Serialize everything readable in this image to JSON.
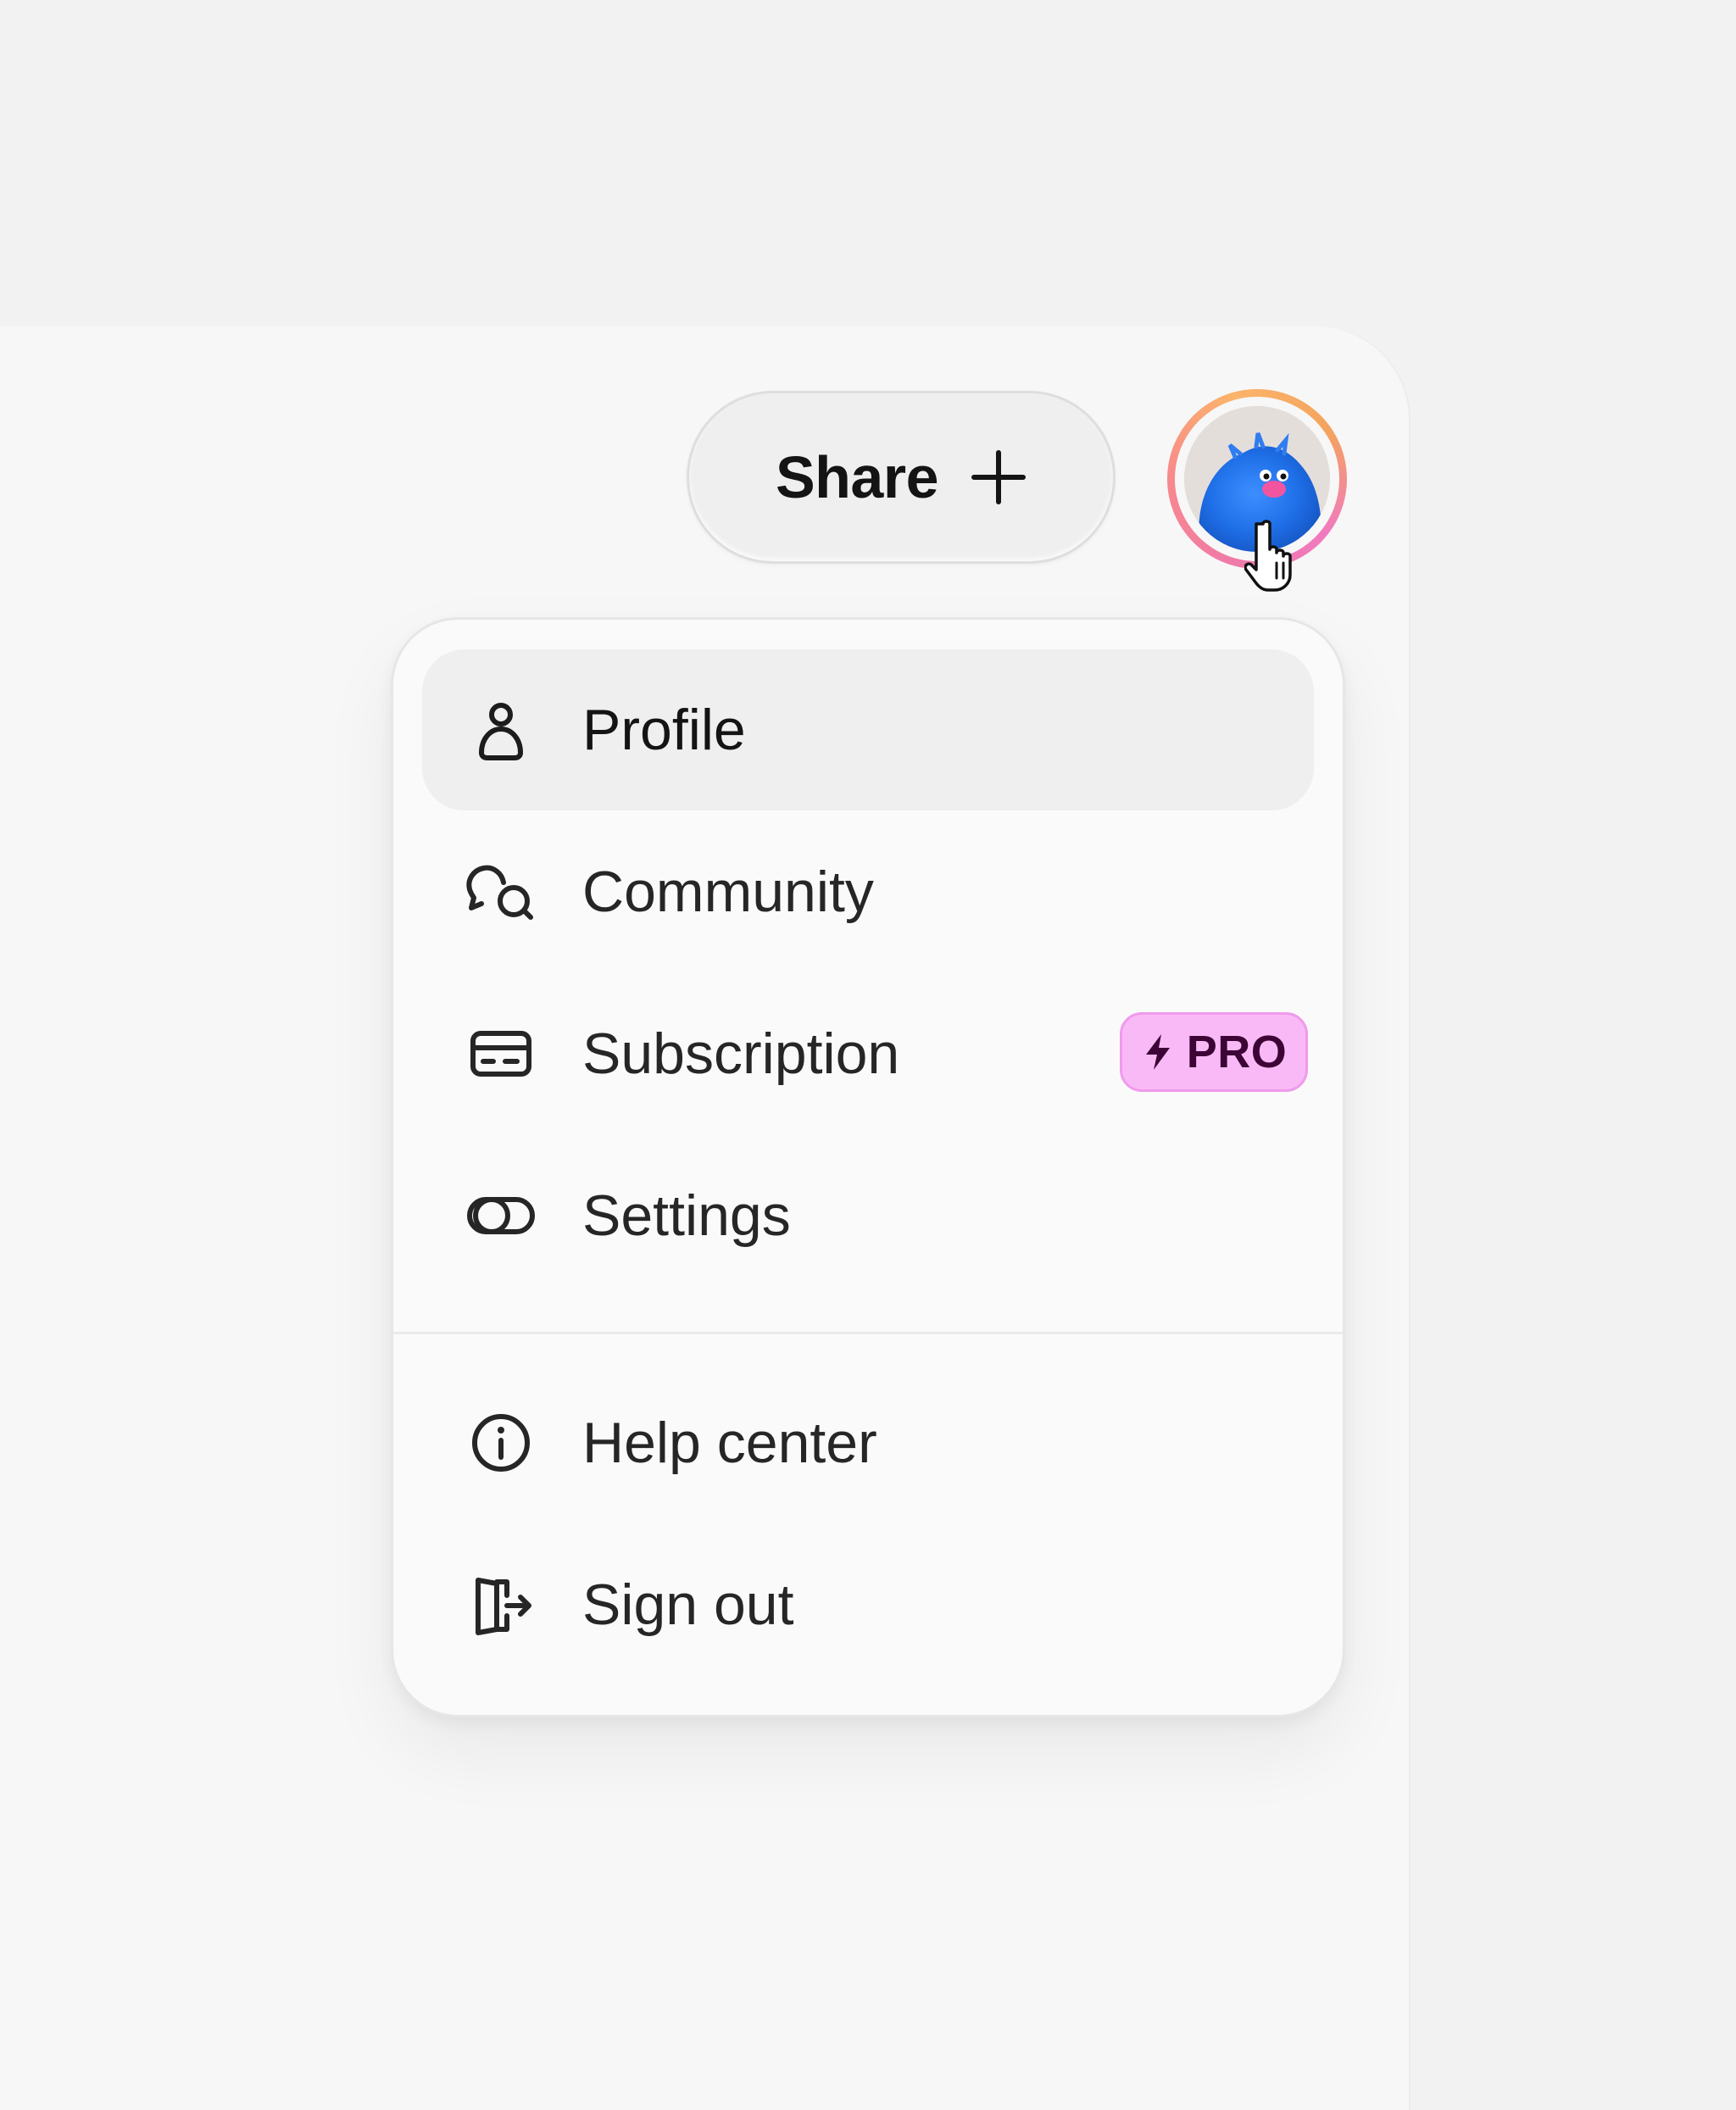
{
  "header": {
    "share_label": "Share",
    "share_icon": "plus-icon",
    "avatar": {
      "icon": "avatar",
      "ring_colors": [
        "#f07aa6",
        "#fbb46a"
      ]
    },
    "cursor_icon": "hand-pointer-icon"
  },
  "menu": {
    "items": [
      {
        "label": "Profile",
        "icon": "user-icon",
        "active": true
      },
      {
        "label": "Community",
        "icon": "chat-bubbles-icon"
      },
      {
        "label": "Subscription",
        "icon": "credit-card-icon",
        "badge": {
          "label": "PRO",
          "icon": "bolt-icon",
          "color": "#f9b9f6"
        }
      },
      {
        "label": "Settings",
        "icon": "toggle-icon"
      }
    ],
    "secondary_items": [
      {
        "label": "Help center",
        "icon": "info-icon"
      },
      {
        "label": "Sign out",
        "icon": "sign-out-icon"
      }
    ]
  },
  "colors": {
    "background": "#f2f2f2",
    "panel": "#f7f7f7",
    "menu": "#fafafa",
    "active_item": "#efefef",
    "pro_badge": "#f9b9f6",
    "pro_text": "#3c0535"
  }
}
